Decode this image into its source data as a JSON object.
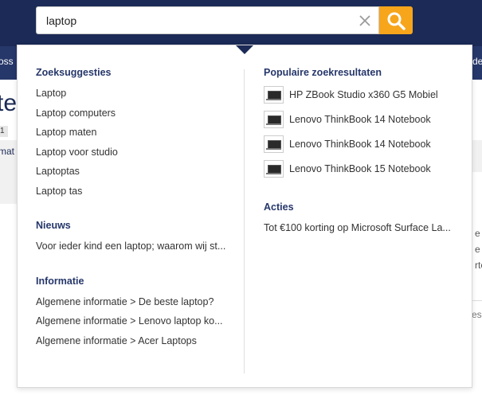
{
  "search": {
    "value": "laptop"
  },
  "background": {
    "nav_left": "oss",
    "nav_right": "de",
    "title_fragment": "te",
    "badge": "1",
    "text_fragment": "mat",
    "right_fragments": [
      "e",
      "e",
      "rte",
      "esu"
    ]
  },
  "suggestions": {
    "title": "Zoeksuggesties",
    "items": [
      "Laptop",
      "Laptop computers",
      "Laptop maten",
      "Laptop voor studio",
      "Laptoptas",
      "Laptop tas"
    ]
  },
  "news": {
    "title": "Nieuws",
    "items": [
      "Voor ieder kind een laptop; waarom wij st..."
    ]
  },
  "info": {
    "title": "Informatie",
    "items": [
      "Algemene informatie > De beste laptop?",
      "Algemene informatie > Lenovo laptop ko...",
      "Algemene informatie > Acer Laptops"
    ]
  },
  "popular": {
    "title": "Populaire zoekresultaten",
    "items": [
      {
        "name": "HP ZBook Studio x360 G5 Mobiel",
        "icon": "laptop-thumbnail"
      },
      {
        "name": "Lenovo ThinkBook 14 Notebook",
        "icon": "laptop-thumbnail"
      },
      {
        "name": "Lenovo ThinkBook 14 Notebook",
        "icon": "laptop-thumbnail"
      },
      {
        "name": "Lenovo ThinkBook 15 Notebook",
        "icon": "laptop-thumbnail"
      }
    ]
  },
  "actions": {
    "title": "Acties",
    "items": [
      "Tot €100 korting op Microsoft Surface La..."
    ]
  },
  "colors": {
    "header": "#1b2a56",
    "accent": "#f7a51b",
    "section_title": "#26376a"
  },
  "icons": {
    "clear": "close-icon",
    "search": "search-icon"
  }
}
